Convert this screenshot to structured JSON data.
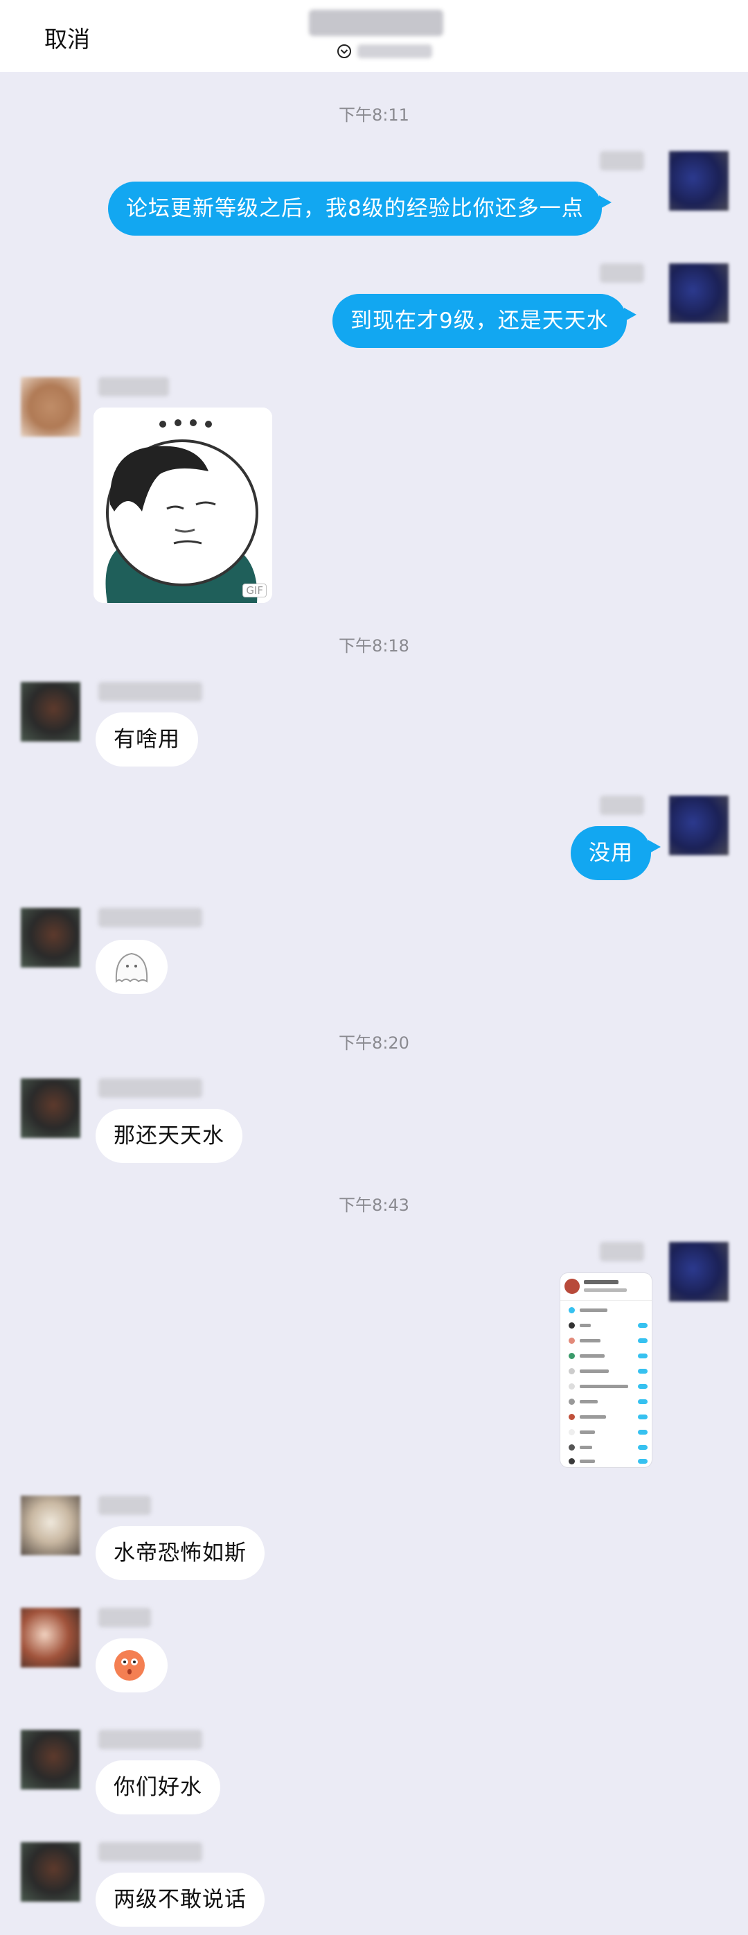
{
  "header": {
    "cancel_label": "取消"
  },
  "times": [
    "下午8:11",
    "下午8:18",
    "下午8:20",
    "下午8:43"
  ],
  "messages": {
    "m1": "论坛更新等级之后，我8级的经验比你还多一点",
    "m2": "到现在才9级，还是天天水",
    "m3": "有啥用",
    "m4": "没用",
    "m5": "那还天天水",
    "m6": "水帝恐怖如斯",
    "m7": "你们好水",
    "m8": "两级不敢说话"
  },
  "sticker": {
    "badge": "GIF"
  },
  "colors": {
    "outgoing_bubble": "#12a7f1",
    "background": "#ebebf5",
    "incoming_bubble": "#ffffff"
  },
  "icons": [
    "chevron-down-circle-icon",
    "ghost-emoji-icon",
    "surprised-face-emoji-icon"
  ]
}
